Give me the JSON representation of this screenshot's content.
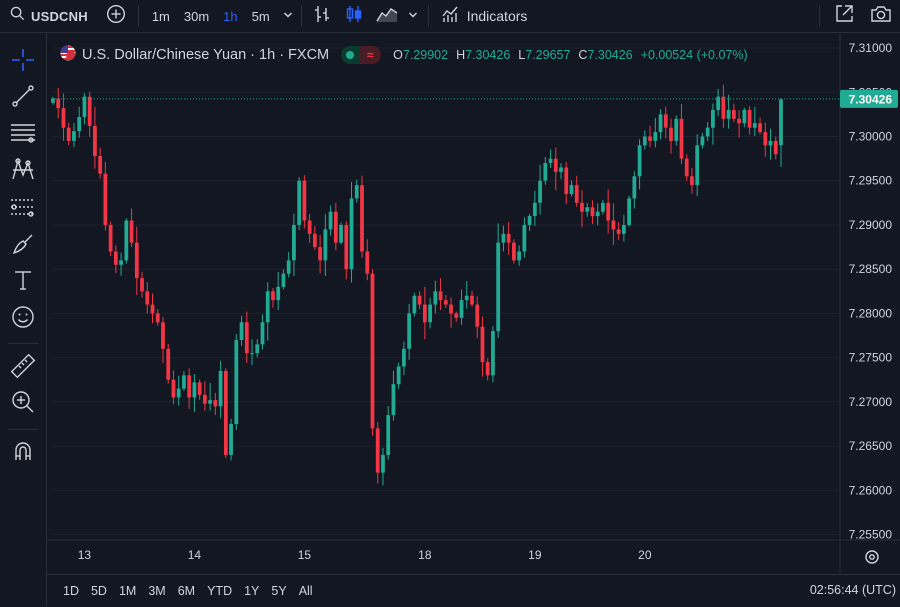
{
  "toolbar": {
    "symbol": "USDCNH",
    "intervals": [
      "1m",
      "30m",
      "1h",
      "5m"
    ],
    "active_interval": "1h",
    "indicators_label": "Indicators"
  },
  "legend": {
    "title": "U.S. Dollar/Chinese Yuan · 1h · FXCM",
    "o_label": "O",
    "o": "7.29902",
    "h_label": "H",
    "h": "7.30426",
    "l_label": "L",
    "l": "7.29657",
    "c_label": "C",
    "c": "7.30426",
    "change": "+0.00524 (+0.07%)",
    "pill_glyph": "≈"
  },
  "price_axis": {
    "labels": [
      "7.31000",
      "7.30500",
      "7.30000",
      "7.29500",
      "7.29000",
      "7.28500",
      "7.28000",
      "7.27500",
      "7.27000",
      "7.26500",
      "7.26000",
      "7.25500"
    ],
    "current": "7.30426"
  },
  "time_axis": {
    "labels": [
      "13",
      "14",
      "15",
      "18",
      "19",
      "20"
    ]
  },
  "ranges": [
    "1D",
    "5D",
    "1M",
    "3M",
    "6M",
    "YTD",
    "1Y",
    "5Y",
    "All"
  ],
  "clock": "02:56:44 (UTC)",
  "colors": {
    "up": "#22ab94",
    "down": "#f23645",
    "background": "#131722",
    "grid": "#1e222d",
    "accent": "#2962ff"
  },
  "chart_data": {
    "type": "candlestick",
    "symbol": "USDCNH",
    "interval": "1h",
    "ylim": [
      7.2545,
      7.3117
    ],
    "yticks": [
      7.31,
      7.305,
      7.3,
      7.295,
      7.29,
      7.285,
      7.28,
      7.275,
      7.27,
      7.265,
      7.26,
      7.255
    ],
    "x_tick_labels": [
      "13",
      "14",
      "15",
      "18",
      "19",
      "20"
    ],
    "closes": [
      7.3043,
      7.3032,
      7.301,
      7.2995,
      7.3006,
      7.3022,
      7.3045,
      7.3012,
      7.2978,
      7.2958,
      7.29,
      7.287,
      7.2855,
      7.286,
      7.2905,
      7.288,
      7.284,
      7.2825,
      7.281,
      7.28,
      7.279,
      7.276,
      7.2725,
      7.2705,
      7.2715,
      7.273,
      7.2705,
      7.2722,
      7.2708,
      7.2698,
      7.2702,
      7.2695,
      7.2735,
      7.264,
      7.2675,
      7.277,
      7.279,
      7.2755,
      7.2755,
      7.2765,
      7.279,
      7.2825,
      7.2815,
      7.283,
      7.2845,
      7.286,
      7.29,
      7.295,
      7.2905,
      7.289,
      7.2875,
      7.286,
      7.2895,
      7.2915,
      7.288,
      7.29,
      7.285,
      7.293,
      7.2945,
      7.287,
      7.2845,
      7.267,
      7.262,
      7.264,
      7.2685,
      7.272,
      7.274,
      7.276,
      7.28,
      7.282,
      7.281,
      7.279,
      7.281,
      7.2825,
      7.2815,
      7.281,
      7.28,
      7.2795,
      7.2815,
      7.282,
      7.281,
      7.2785,
      7.2745,
      7.273,
      7.278,
      7.288,
      7.289,
      7.288,
      7.286,
      7.287,
      7.29,
      7.291,
      7.2925,
      7.295,
      7.297,
      7.2975,
      7.296,
      7.2965,
      7.2935,
      7.2945,
      7.2925,
      7.2915,
      7.292,
      7.291,
      7.2915,
      7.2925,
      7.2905,
      7.2895,
      7.289,
      7.29,
      7.293,
      7.2955,
      7.299,
      7.3,
      7.2995,
      7.3005,
      7.3025,
      7.301,
      7.2995,
      7.302,
      7.2975,
      7.2955,
      7.2945,
      7.299,
      7.3,
      7.301,
      7.303,
      7.3045,
      7.302,
      7.303,
      7.302,
      7.3015,
      7.303,
      7.301,
      7.3015,
      7.3005,
      7.299,
      7.2995,
      7.298,
      7.3042
    ],
    "current_price": 7.30426,
    "ohlc_last": {
      "o": 7.29902,
      "h": 7.30426,
      "l": 7.29657,
      "c": 7.30426
    }
  }
}
